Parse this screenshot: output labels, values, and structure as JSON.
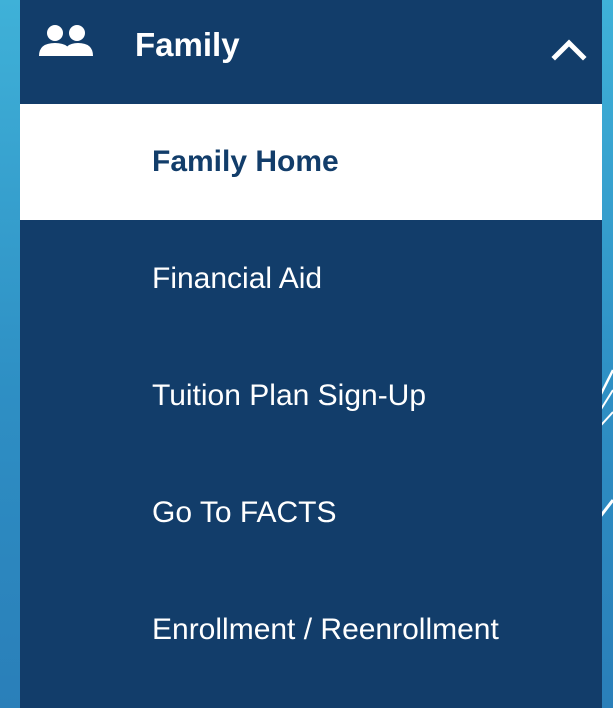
{
  "menu": {
    "header": {
      "label": "Family",
      "icon": "users-icon",
      "toggle_icon": "chevron-up-icon",
      "expanded": true
    },
    "items": [
      {
        "label": "Family Home",
        "active": true
      },
      {
        "label": "Financial Aid",
        "active": false
      },
      {
        "label": "Tuition Plan Sign-Up",
        "active": false
      },
      {
        "label": "Go To FACTS",
        "active": false
      },
      {
        "label": "Enrollment / Reenrollment",
        "active": false
      }
    ]
  },
  "colors": {
    "panel_background": "#123d6a",
    "active_background": "#ffffff",
    "active_text": "#123d6a",
    "text": "#ffffff",
    "page_background": "#3fb1d8"
  }
}
